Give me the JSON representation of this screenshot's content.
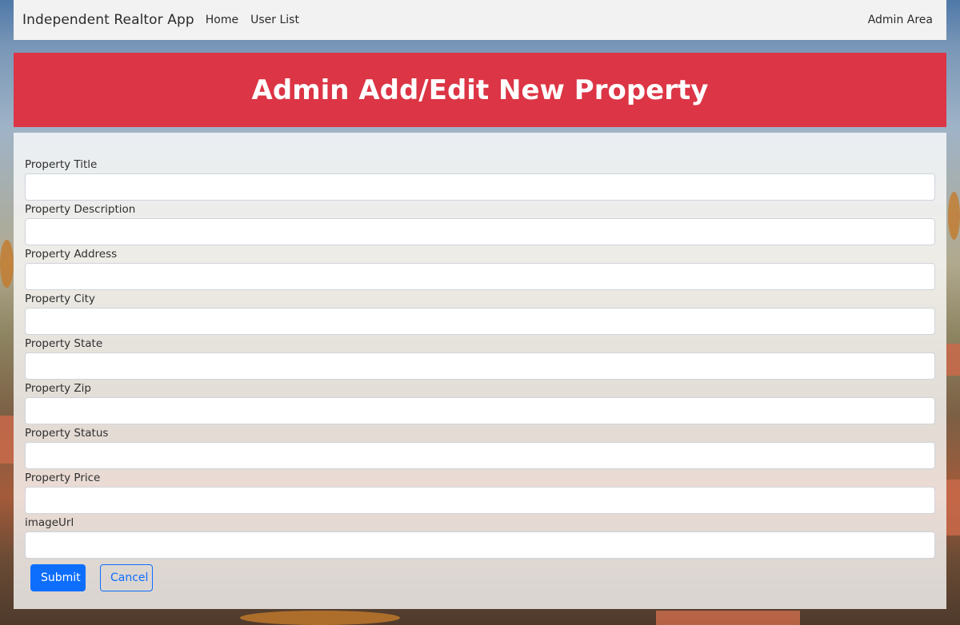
{
  "navbar": {
    "brand": "Independent Realtor App",
    "links": [
      "Home",
      "User List"
    ],
    "right_link": "Admin Area"
  },
  "header": {
    "title": "Admin Add/Edit New Property",
    "color": "#dc3545"
  },
  "form": {
    "fields": [
      {
        "label": "Property Title",
        "value": "",
        "placeholder": ""
      },
      {
        "label": "Property Description",
        "value": "",
        "placeholder": ""
      },
      {
        "label": "Property Address",
        "value": "",
        "placeholder": ""
      },
      {
        "label": "Property City",
        "value": "",
        "placeholder": ""
      },
      {
        "label": "Property State",
        "value": "",
        "placeholder": ""
      },
      {
        "label": "Property Zip",
        "value": "",
        "placeholder": ""
      },
      {
        "label": "Property Status",
        "value": "",
        "placeholder": ""
      },
      {
        "label": "Property Price",
        "value": "",
        "placeholder": ""
      },
      {
        "label": "imageUrl",
        "value": "",
        "placeholder": ""
      }
    ],
    "submit_label": "Submit",
    "cancel_label": "Cancel",
    "accent": "#0d6efd"
  }
}
